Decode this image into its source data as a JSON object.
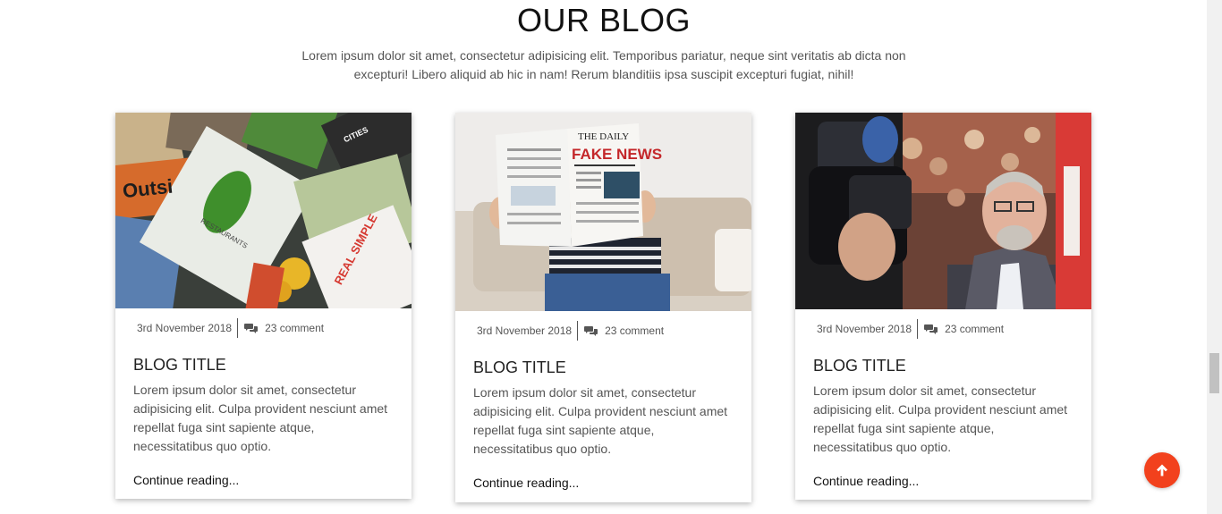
{
  "section": {
    "title": "OUR BLOG",
    "intro": "Lorem ipsum dolor sit amet, consectetur adipisicing elit. Temporibus pariatur, neque sint veritatis ab dicta non excepturi! Libero aliquid ab hic in nam! Rerum blanditiis ipsa suscipit excepturi fugiat, nihil!"
  },
  "posts": [
    {
      "image": "magazines-photo",
      "image_text": [
        "Outsi",
        "RESTAURANTS",
        "REAL SIMPLE",
        "CITIES"
      ],
      "date": "3rd November 2018",
      "comments": "23 comment",
      "title": "BLOG TITLE",
      "excerpt": "Lorem ipsum dolor sit amet, consectetur adipisicing elit. Culpa provident nesciunt amet repellat fuga sint sapiente atque, necessitatibus quo optio.",
      "link": "Continue reading..."
    },
    {
      "image": "newspaper-reader-photo",
      "image_text": [
        "THE DAILY",
        "FAKE NEWS"
      ],
      "date": "3rd November 2018",
      "comments": "23 comment",
      "title": "BLOG TITLE",
      "excerpt": "Lorem ipsum dolor sit amet, consectetur adipisicing elit. Culpa provident nesciunt amet repellat fuga sint sapiente atque, necessitatibus quo optio.",
      "link": "Continue reading..."
    },
    {
      "image": "press-camera-photo",
      "date": "3rd November 2018",
      "comments": "23 comment",
      "title": "BLOG TITLE",
      "excerpt": "Lorem ipsum dolor sit amet, consectetur adipisicing elit. Culpa provident nesciunt amet repellat fuga sint sapiente atque, necessitatibus quo optio.",
      "link": "Continue reading..."
    }
  ],
  "icons": {
    "comment": "comments-icon",
    "back_to_top": "arrow-up-icon"
  },
  "colors": {
    "accent": "#f2411d",
    "text": "#555555",
    "heading": "#111111"
  }
}
